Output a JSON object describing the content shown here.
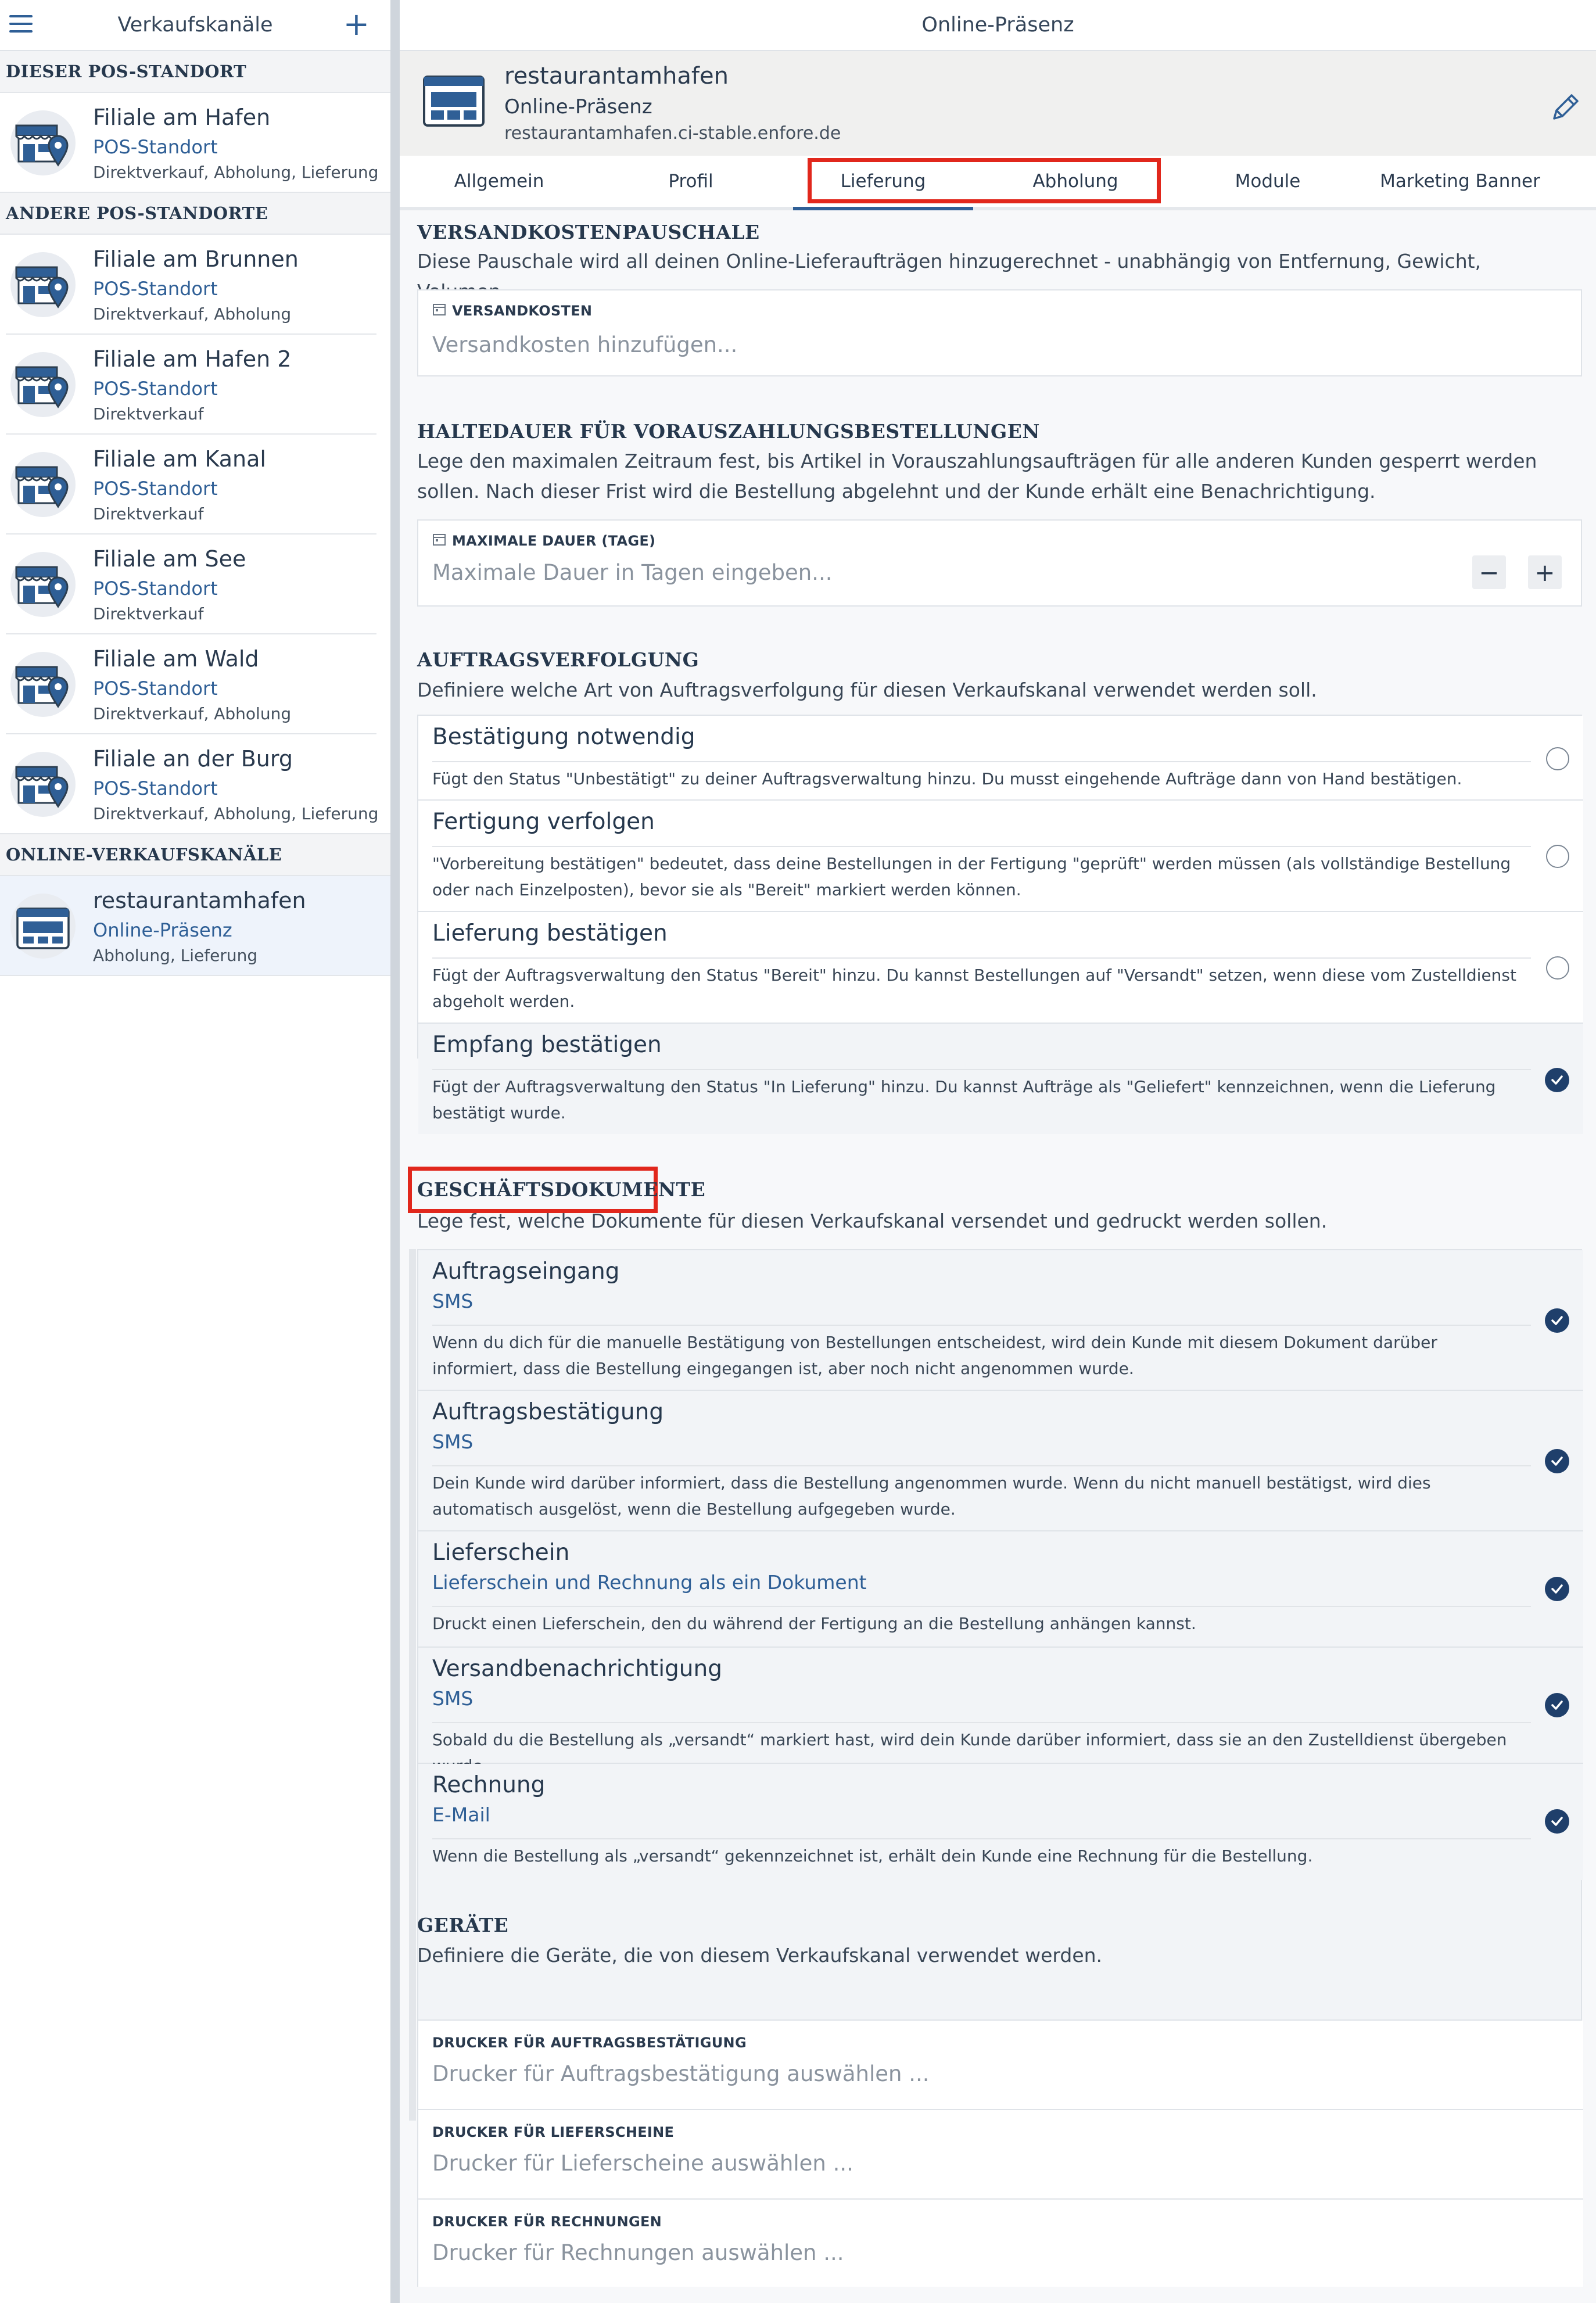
{
  "sidebar": {
    "title": "Verkaufskanäle",
    "add_label": "+",
    "sections": {
      "this_pos": "DIESER POS-STANDORT",
      "other_pos": "ANDERE POS-STANDORTE",
      "online": "ONLINE-VERKAUFSKANÄLE"
    },
    "items": [
      {
        "name": "Filiale am Hafen",
        "type": "POS-Standort",
        "tags": "Direktverkauf, Abholung, Lieferung"
      },
      {
        "name": "Filiale am Brunnen",
        "type": "POS-Standort",
        "tags": "Direktverkauf, Abholung"
      },
      {
        "name": "Filiale am Hafen 2",
        "type": "POS-Standort",
        "tags": "Direktverkauf"
      },
      {
        "name": "Filiale am Kanal",
        "type": "POS-Standort",
        "tags": "Direktverkauf"
      },
      {
        "name": "Filiale am See",
        "type": "POS-Standort",
        "tags": "Direktverkauf"
      },
      {
        "name": "Filiale am Wald",
        "type": "POS-Standort",
        "tags": "Direktverkauf, Abholung"
      },
      {
        "name": "Filiale an der Burg",
        "type": "POS-Standort",
        "tags": "Direktverkauf, Abholung, Lieferung"
      },
      {
        "name": "restaurantamhafen",
        "type": "Online-Präsenz",
        "tags": "Abholung, Lieferung"
      }
    ]
  },
  "main": {
    "title": "Online-Präsenz",
    "profile": {
      "name": "restaurantamhafen",
      "type": "Online-Präsenz",
      "url": "restaurantamhafen.ci-stable.enfore.de"
    },
    "tabs": [
      "Allgemein",
      "Profil",
      "Lieferung",
      "Abholung",
      "Module",
      "Marketing Banner"
    ],
    "active_tab": "Lieferung",
    "shipping": {
      "title": "VERSANDKOSTENPAUSCHALE",
      "desc": "Diese Pauschale wird all deinen Online-Lieferaufträgen hinzugerechnet - unabhängig von Entfernung, Gewicht, Volumen.",
      "field_label": "VERSANDKOSTEN",
      "placeholder": "Versandkosten hinzufügen..."
    },
    "hold": {
      "title": "HALTEDAUER FÜR VORAUSZAHLUNGSBESTELLUNGEN",
      "desc": "Lege den maximalen Zeitraum fest, bis Artikel in Vorauszahlungsaufträgen für alle anderen Kunden gesperrt werden sollen. Nach dieser Frist wird die Bestellung abgelehnt und der Kunde erhält eine Benachrichtigung.",
      "field_label": "MAXIMALE DAUER (TAGE)",
      "placeholder": "Maximale Dauer in Tagen eingeben...",
      "minus": "−",
      "plus": "+"
    },
    "tracking": {
      "title": "AUFTRAGSVERFOLGUNG",
      "desc": "Definiere welche Art von Auftragsverfolgung für diesen Verkaufskanal verwendet werden soll.",
      "options": [
        {
          "title": "Bestätigung notwendig",
          "desc": "Fügt den Status \"Unbestätigt\" zu deiner Auftragsverwaltung hinzu. Du musst eingehende Aufträge dann von Hand bestätigen.",
          "selected": false
        },
        {
          "title": "Fertigung verfolgen",
          "desc": "\"Vorbereitung bestätigen\" bedeutet, dass deine Bestellungen in der Fertigung \"geprüft\" werden müssen (als vollständige Bestellung oder nach Einzelposten), bevor sie als \"Bereit\" markiert werden können.",
          "selected": false
        },
        {
          "title": "Lieferung bestätigen",
          "desc": "Fügt der Auftragsverwaltung den Status \"Bereit\" hinzu. Du kannst Bestellungen auf \"Versandt\" setzen, wenn diese vom Zustelldienst abgeholt werden.",
          "selected": false
        },
        {
          "title": "Empfang bestätigen",
          "desc": "Fügt der Auftragsverwaltung den Status \"In Lieferung\" hinzu. Du kannst Aufträge als \"Geliefert\" kennzeichnen, wenn die Lieferung bestätigt wurde.",
          "selected": true
        }
      ]
    },
    "documents": {
      "title": "GESCHÄFTSDOKUMENTE",
      "desc": "Lege fest, welche Dokumente für diesen Verkaufskanal versendet und gedruckt werden sollen.",
      "items": [
        {
          "title": "Auftragseingang",
          "sub": "SMS",
          "desc": "Wenn du dich für die manuelle Bestätigung von Bestellungen entscheidest, wird dein Kunde mit diesem Dokument darüber informiert, dass die Bestellung eingegangen ist, aber noch nicht angenommen wurde.",
          "checked": true
        },
        {
          "title": "Auftragsbestätigung",
          "sub": "SMS",
          "desc": "Dein Kunde wird darüber informiert, dass die Bestellung angenommen wurde. Wenn du nicht manuell bestätigst, wird dies automatisch ausgelöst, wenn die Bestellung aufgegeben wurde.",
          "checked": true
        },
        {
          "title": "Lieferschein",
          "sub": "Lieferschein und Rechnung als ein Dokument",
          "desc": "Druckt einen Lieferschein, den du während der Fertigung an die Bestellung anhängen kannst.",
          "checked": true
        },
        {
          "title": "Versandbenachrichtigung",
          "sub": "SMS",
          "desc": "Sobald du die Bestellung als „versandt“ markiert hast, wird dein Kunde darüber informiert, dass sie an den Zustelldienst übergeben wurde.",
          "checked": true
        },
        {
          "title": "Rechnung",
          "sub": "E-Mail",
          "desc": "Wenn die Bestellung als „versandt“ gekennzeichnet ist, erhält dein Kunde eine Rechnung für die Bestellung.",
          "checked": true
        }
      ]
    },
    "devices": {
      "title": "GERÄTE",
      "desc": "Definiere die Geräte, die von diesem Verkaufskanal verwendet werden.",
      "fields": [
        {
          "label": "DRUCKER FÜR AUFTRAGSBESTÄTIGUNG",
          "placeholder": "Drucker für Auftragsbestätigung auswählen ..."
        },
        {
          "label": "DRUCKER FÜR LIEFERSCHEINE",
          "placeholder": "Drucker für Lieferscheine auswählen ..."
        },
        {
          "label": "DRUCKER FÜR RECHNUNGEN",
          "placeholder": "Drucker für Rechnungen auswählen ..."
        }
      ]
    }
  },
  "colors": {
    "accent": "#2f5f96",
    "highlight": "#e1271c",
    "check": "#1f3f6b"
  },
  "icons": {
    "menu": "hamburger-icon",
    "add": "plus-icon",
    "store": "store-location-icon",
    "web": "browser-window-icon",
    "edit": "pencil-icon",
    "field": "calendar-icon",
    "check": "checkmark-icon"
  }
}
